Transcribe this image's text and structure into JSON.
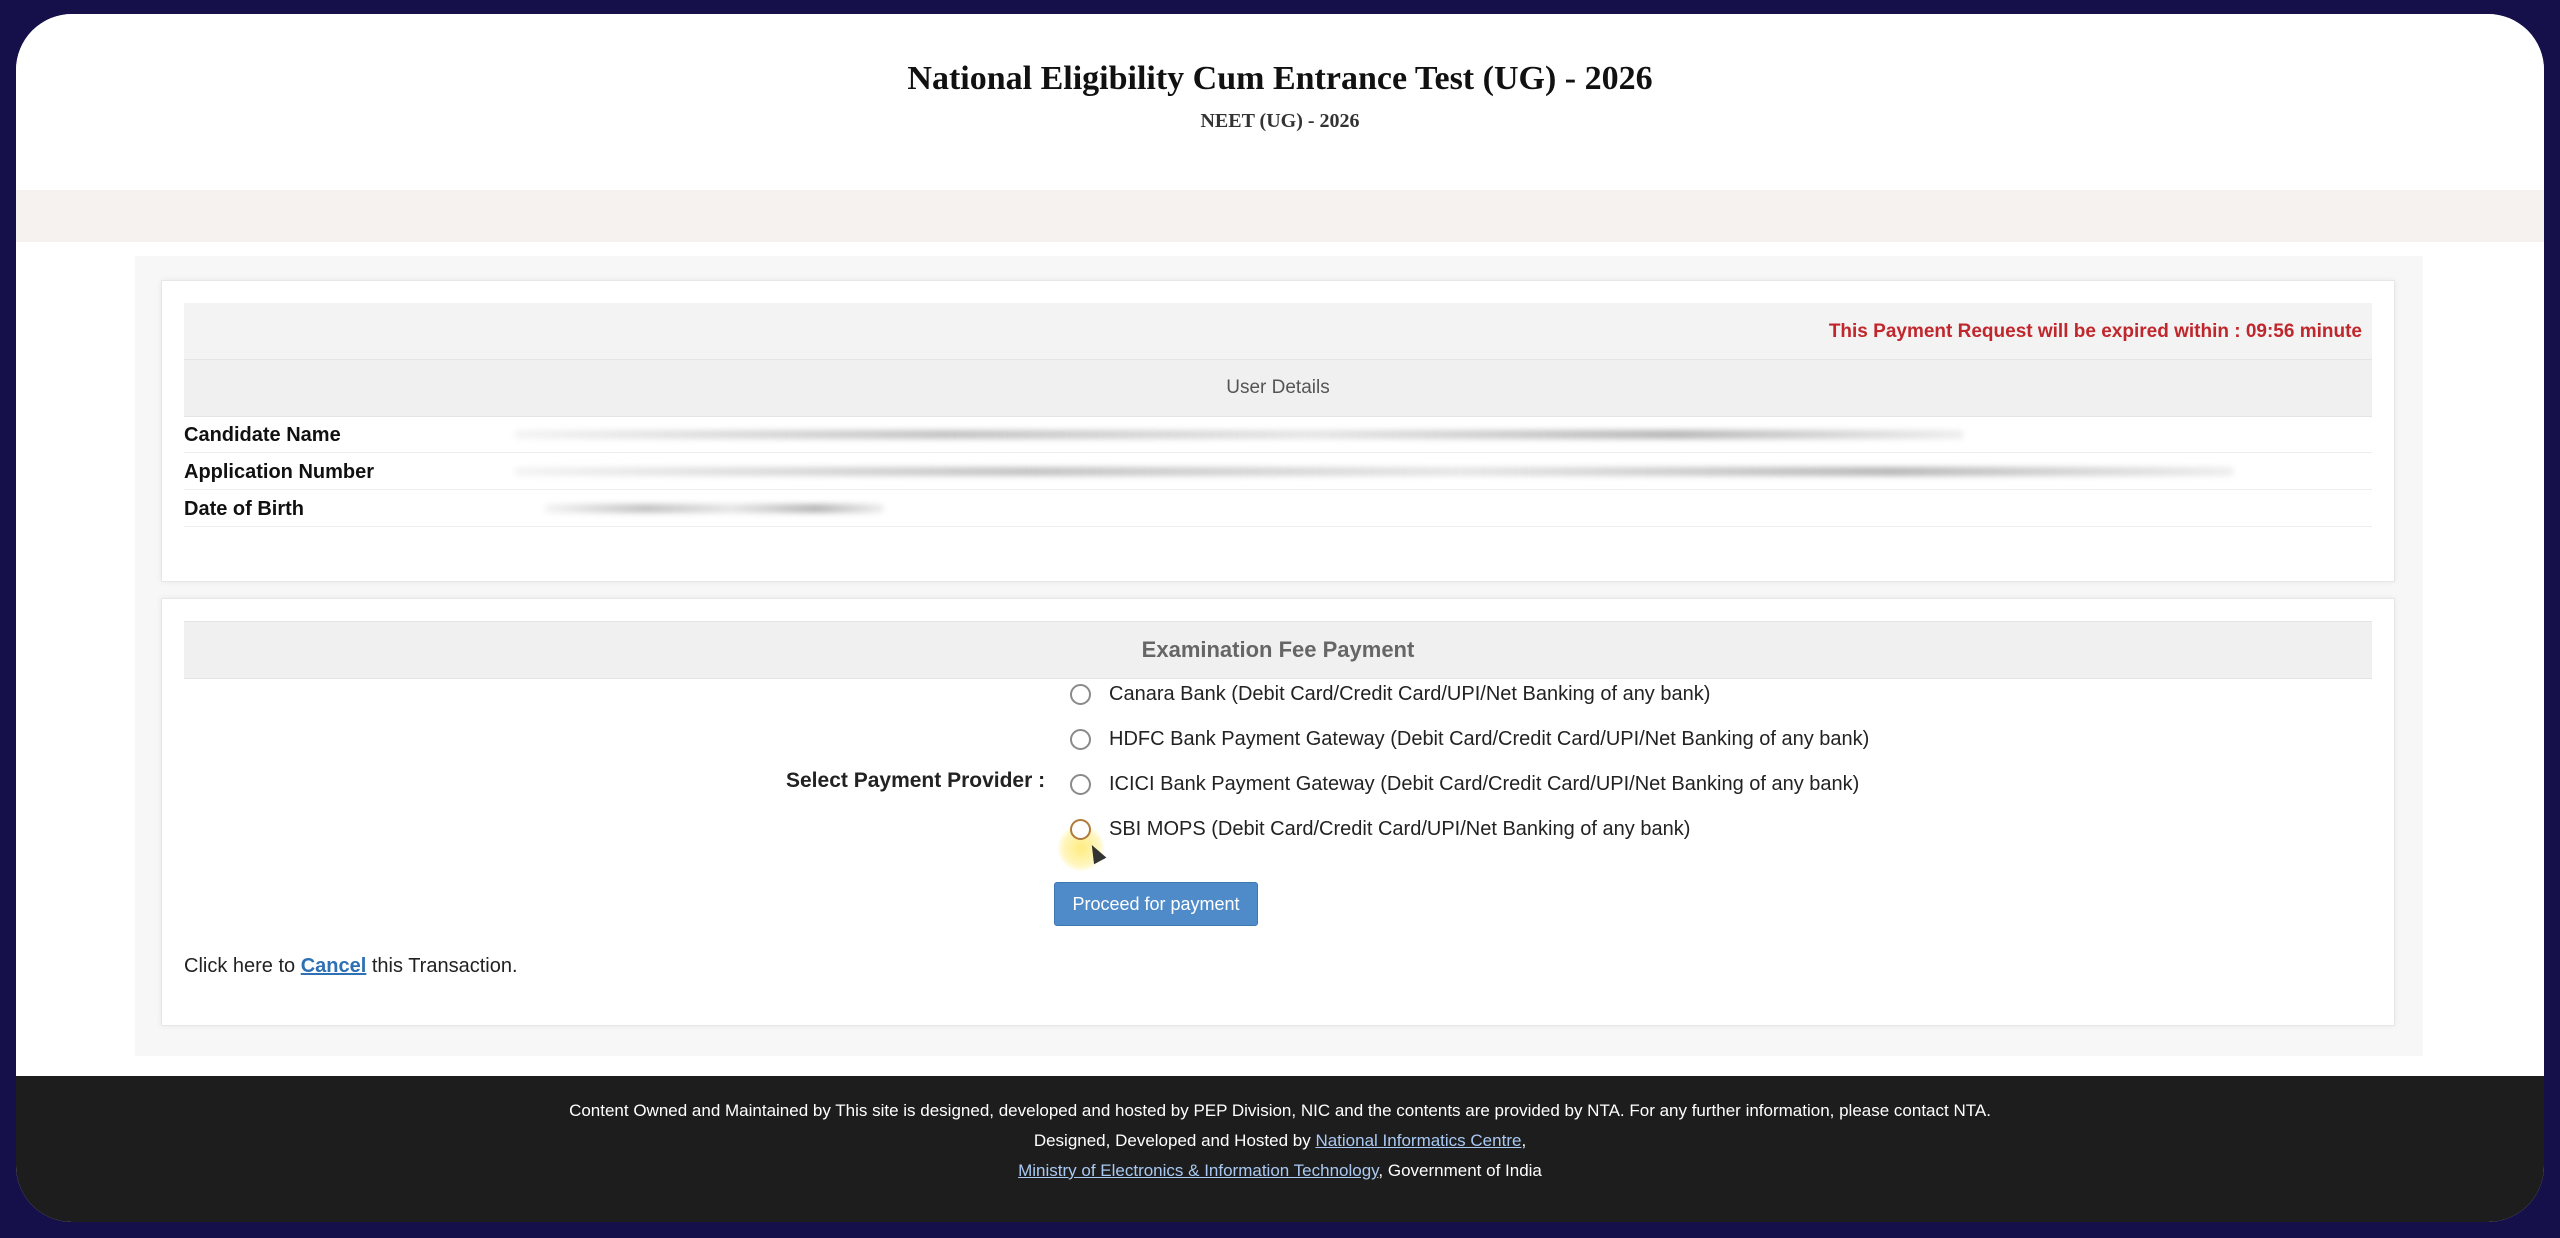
{
  "header": {
    "title": "National Eligibility Cum Entrance Test (UG) - 2026",
    "subtitle": "NEET (UG) - 2026"
  },
  "expiry_notice": "This Payment Request will be expired within : 09:56 minute",
  "user_details": {
    "heading": "User Details",
    "rows": [
      {
        "label": "Candidate Name"
      },
      {
        "label": "Application Number"
      },
      {
        "label": "Date of Birth"
      }
    ]
  },
  "payment": {
    "heading": "Examination Fee Payment",
    "provider_label": "Select Payment Provider :",
    "options": [
      "Canara Bank (Debit Card/Credit Card/UPI/Net Banking of any bank)",
      "HDFC Bank Payment Gateway (Debit Card/Credit Card/UPI/Net Banking of any bank)",
      "ICICI Bank Payment Gateway (Debit Card/Credit Card/UPI/Net Banking of any bank)",
      "SBI MOPS (Debit Card/Credit Card/UPI/Net Banking of any bank)"
    ],
    "proceed_label": "Proceed for payment",
    "cancel_prefix": "Click here to ",
    "cancel_link": "Cancel",
    "cancel_suffix": " this Transaction."
  },
  "footer": {
    "line1": "Content Owned and Maintained by This site is designed, developed and hosted by PEP Division, NIC and the contents are provided by NTA. For any further information, please contact NTA.",
    "line2_prefix": "Designed, Developed and Hosted by ",
    "line2_link": "National Informatics Centre",
    "line2_suffix": ",",
    "line3_link": "Ministry of Electronics & Information Technology",
    "line3_suffix": ", Government of India"
  }
}
